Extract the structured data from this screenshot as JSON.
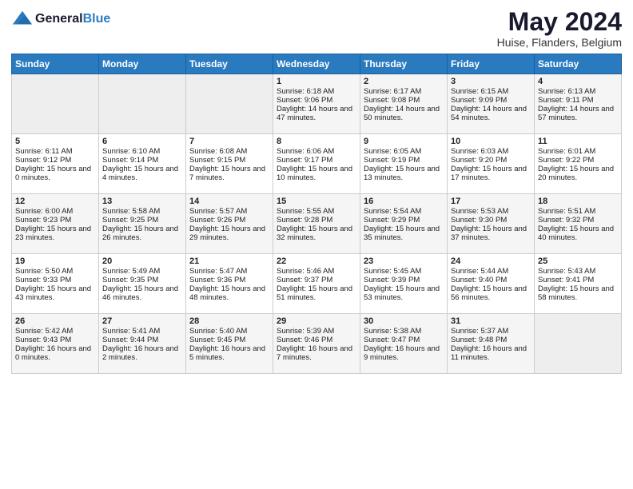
{
  "header": {
    "logo_line1": "General",
    "logo_line2": "Blue",
    "month": "May 2024",
    "location": "Huise, Flanders, Belgium"
  },
  "days_of_week": [
    "Sunday",
    "Monday",
    "Tuesday",
    "Wednesday",
    "Thursday",
    "Friday",
    "Saturday"
  ],
  "weeks": [
    [
      {
        "day": "",
        "content": ""
      },
      {
        "day": "",
        "content": ""
      },
      {
        "day": "",
        "content": ""
      },
      {
        "day": "1",
        "content": "Sunrise: 6:18 AM\nSunset: 9:06 PM\nDaylight: 14 hours and 47 minutes."
      },
      {
        "day": "2",
        "content": "Sunrise: 6:17 AM\nSunset: 9:08 PM\nDaylight: 14 hours and 50 minutes."
      },
      {
        "day": "3",
        "content": "Sunrise: 6:15 AM\nSunset: 9:09 PM\nDaylight: 14 hours and 54 minutes."
      },
      {
        "day": "4",
        "content": "Sunrise: 6:13 AM\nSunset: 9:11 PM\nDaylight: 14 hours and 57 minutes."
      }
    ],
    [
      {
        "day": "5",
        "content": "Sunrise: 6:11 AM\nSunset: 9:12 PM\nDaylight: 15 hours and 0 minutes."
      },
      {
        "day": "6",
        "content": "Sunrise: 6:10 AM\nSunset: 9:14 PM\nDaylight: 15 hours and 4 minutes."
      },
      {
        "day": "7",
        "content": "Sunrise: 6:08 AM\nSunset: 9:15 PM\nDaylight: 15 hours and 7 minutes."
      },
      {
        "day": "8",
        "content": "Sunrise: 6:06 AM\nSunset: 9:17 PM\nDaylight: 15 hours and 10 minutes."
      },
      {
        "day": "9",
        "content": "Sunrise: 6:05 AM\nSunset: 9:19 PM\nDaylight: 15 hours and 13 minutes."
      },
      {
        "day": "10",
        "content": "Sunrise: 6:03 AM\nSunset: 9:20 PM\nDaylight: 15 hours and 17 minutes."
      },
      {
        "day": "11",
        "content": "Sunrise: 6:01 AM\nSunset: 9:22 PM\nDaylight: 15 hours and 20 minutes."
      }
    ],
    [
      {
        "day": "12",
        "content": "Sunrise: 6:00 AM\nSunset: 9:23 PM\nDaylight: 15 hours and 23 minutes."
      },
      {
        "day": "13",
        "content": "Sunrise: 5:58 AM\nSunset: 9:25 PM\nDaylight: 15 hours and 26 minutes."
      },
      {
        "day": "14",
        "content": "Sunrise: 5:57 AM\nSunset: 9:26 PM\nDaylight: 15 hours and 29 minutes."
      },
      {
        "day": "15",
        "content": "Sunrise: 5:55 AM\nSunset: 9:28 PM\nDaylight: 15 hours and 32 minutes."
      },
      {
        "day": "16",
        "content": "Sunrise: 5:54 AM\nSunset: 9:29 PM\nDaylight: 15 hours and 35 minutes."
      },
      {
        "day": "17",
        "content": "Sunrise: 5:53 AM\nSunset: 9:30 PM\nDaylight: 15 hours and 37 minutes."
      },
      {
        "day": "18",
        "content": "Sunrise: 5:51 AM\nSunset: 9:32 PM\nDaylight: 15 hours and 40 minutes."
      }
    ],
    [
      {
        "day": "19",
        "content": "Sunrise: 5:50 AM\nSunset: 9:33 PM\nDaylight: 15 hours and 43 minutes."
      },
      {
        "day": "20",
        "content": "Sunrise: 5:49 AM\nSunset: 9:35 PM\nDaylight: 15 hours and 46 minutes."
      },
      {
        "day": "21",
        "content": "Sunrise: 5:47 AM\nSunset: 9:36 PM\nDaylight: 15 hours and 48 minutes."
      },
      {
        "day": "22",
        "content": "Sunrise: 5:46 AM\nSunset: 9:37 PM\nDaylight: 15 hours and 51 minutes."
      },
      {
        "day": "23",
        "content": "Sunrise: 5:45 AM\nSunset: 9:39 PM\nDaylight: 15 hours and 53 minutes."
      },
      {
        "day": "24",
        "content": "Sunrise: 5:44 AM\nSunset: 9:40 PM\nDaylight: 15 hours and 56 minutes."
      },
      {
        "day": "25",
        "content": "Sunrise: 5:43 AM\nSunset: 9:41 PM\nDaylight: 15 hours and 58 minutes."
      }
    ],
    [
      {
        "day": "26",
        "content": "Sunrise: 5:42 AM\nSunset: 9:43 PM\nDaylight: 16 hours and 0 minutes."
      },
      {
        "day": "27",
        "content": "Sunrise: 5:41 AM\nSunset: 9:44 PM\nDaylight: 16 hours and 2 minutes."
      },
      {
        "day": "28",
        "content": "Sunrise: 5:40 AM\nSunset: 9:45 PM\nDaylight: 16 hours and 5 minutes."
      },
      {
        "day": "29",
        "content": "Sunrise: 5:39 AM\nSunset: 9:46 PM\nDaylight: 16 hours and 7 minutes."
      },
      {
        "day": "30",
        "content": "Sunrise: 5:38 AM\nSunset: 9:47 PM\nDaylight: 16 hours and 9 minutes."
      },
      {
        "day": "31",
        "content": "Sunrise: 5:37 AM\nSunset: 9:48 PM\nDaylight: 16 hours and 11 minutes."
      },
      {
        "day": "",
        "content": ""
      }
    ]
  ]
}
